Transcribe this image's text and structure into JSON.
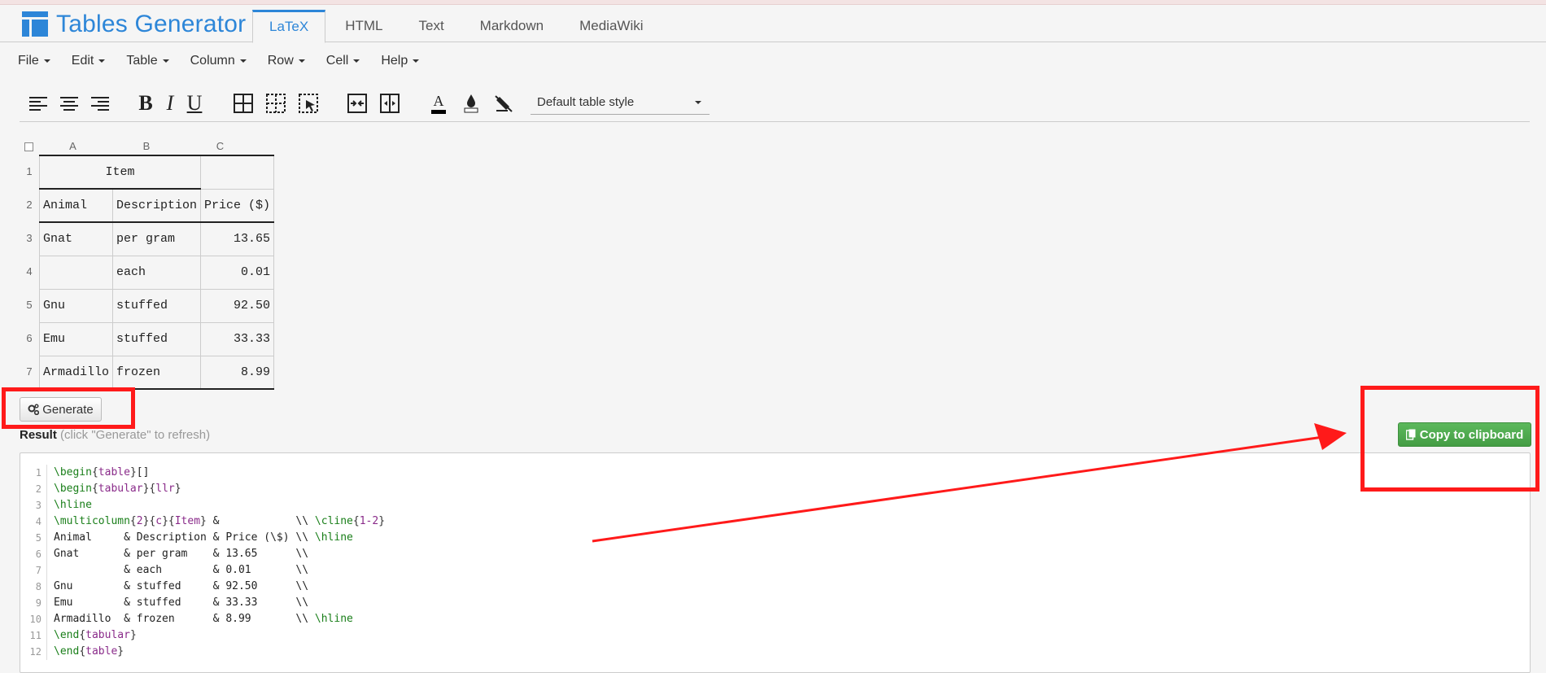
{
  "app": {
    "title": "Tables Generator",
    "tabs": [
      {
        "label": "LaTeX",
        "active": true
      },
      {
        "label": "HTML",
        "active": false
      },
      {
        "label": "Text",
        "active": false
      },
      {
        "label": "Markdown",
        "active": false
      },
      {
        "label": "MediaWiki",
        "active": false
      }
    ]
  },
  "menu": [
    "File",
    "Edit",
    "Table",
    "Column",
    "Row",
    "Cell",
    "Help"
  ],
  "toolbar": {
    "bold": "B",
    "italic": "I",
    "underline": "U",
    "text_color_letter": "A",
    "table_style": "Default table style"
  },
  "sheet": {
    "columns": [
      "A",
      "B",
      "C"
    ],
    "rows": [
      "1",
      "2",
      "3",
      "4",
      "5",
      "6",
      "7"
    ],
    "cells": {
      "r1": {
        "merged": "Item",
        "c": ""
      },
      "r2": {
        "a": "Animal",
        "b": "Description",
        "c": "Price ($)"
      },
      "r3": {
        "a": "Gnat",
        "b": "per gram",
        "c": "13.65"
      },
      "r4": {
        "a": "",
        "b": "each",
        "c": "0.01"
      },
      "r5": {
        "a": "Gnu",
        "b": "stuffed",
        "c": "92.50"
      },
      "r6": {
        "a": "Emu",
        "b": "stuffed",
        "c": "33.33"
      },
      "r7": {
        "a": "Armadillo",
        "b": "frozen",
        "c": "8.99"
      }
    }
  },
  "generate": {
    "button_label": "Generate",
    "result_label": "Result",
    "result_hint": "(click \"Generate\" to refresh)"
  },
  "copy": {
    "label": "Copy to clipboard"
  },
  "code": {
    "line_numbers": [
      "1",
      "2",
      "3",
      "4",
      "5",
      "6",
      "7",
      "8",
      "9",
      "10",
      "11",
      "12"
    ],
    "lines": [
      "\\begin{table}[]",
      "\\begin{tabular}{llr}",
      "\\hline",
      "\\multicolumn{2}{c}{Item} &            \\\\ \\cline{1-2}",
      "Animal     & Description & Price (\\$) \\\\ \\hline",
      "Gnat       & per gram    & 13.65      \\\\",
      "           & each        & 0.01       \\\\",
      "Gnu        & stuffed     & 92.50      \\\\",
      "Emu        & stuffed     & 33.33      \\\\",
      "Armadillo  & frozen      & 8.99       \\\\ \\hline",
      "\\end{tabular}",
      "\\end{table}"
    ]
  },
  "colors": {
    "brand": "#2d86d8",
    "annotation": "#ff1a1a",
    "copy_button": "#5cb85c"
  }
}
